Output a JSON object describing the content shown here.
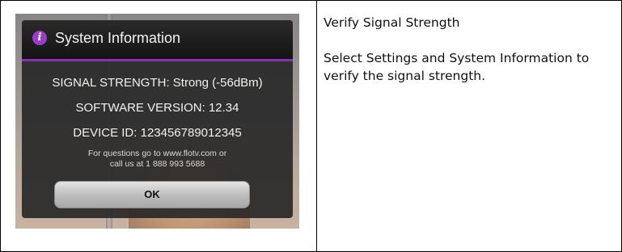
{
  "dialog": {
    "title": "System Information",
    "signal_strength": "SIGNAL STRENGTH:  Strong (-56dBm)",
    "software_version": "SOFTWARE VERSION:  12.34",
    "device_id": "DEVICE ID: 123456789012345",
    "help_line1": "For questions go to www.flotv.com or",
    "help_line2": "call us at 1 888 993 5688",
    "ok_label": "OK",
    "icon": "info-icon",
    "icon_glyph": "i"
  },
  "right": {
    "title": "Verify Signal Strength",
    "body": "Select Settings and System Information to verify the signal strength."
  },
  "colors": {
    "accent": "#8a2fb5",
    "dialog_bg": "#282828"
  }
}
